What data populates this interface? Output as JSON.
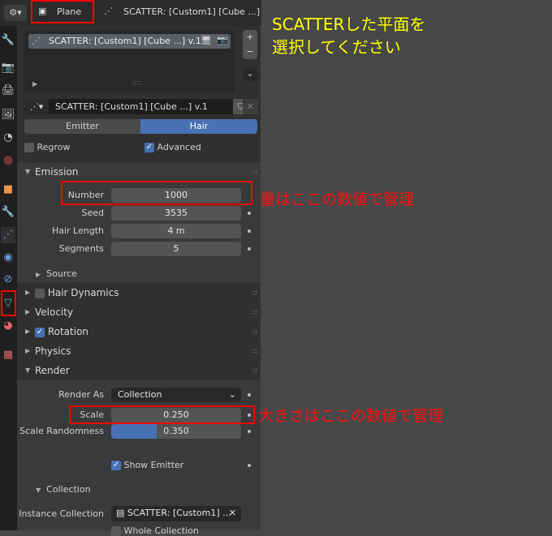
{
  "header": {
    "object_name": "Plane",
    "breadcrumb": "SCATTER: [Custom1] [Cube ...] v.1"
  },
  "particle_list": {
    "items": [
      {
        "name": "SCATTER: [Custom1] [Cube ...] v.1"
      }
    ]
  },
  "datablock": {
    "name": "SCATTER: [Custom1] [Cube ...] v.1"
  },
  "type_tabs": [
    {
      "label": "Emitter",
      "active": false
    },
    {
      "label": "Hair",
      "active": true
    }
  ],
  "options": {
    "regrow": "Regrow",
    "advanced": "Advanced"
  },
  "emission": {
    "title": "Emission",
    "fields": [
      {
        "label": "Number",
        "value": "1000"
      },
      {
        "label": "Seed",
        "value": "3535"
      },
      {
        "label": "Hair Length",
        "value": "4 m"
      },
      {
        "label": "Segments",
        "value": "5"
      }
    ],
    "source": "Source"
  },
  "panels": [
    "Hair Dynamics",
    "Velocity",
    "Rotation",
    "Physics"
  ],
  "render": {
    "title": "Render",
    "render_as_label": "Render As",
    "render_as_value": "Collection",
    "scale_label": "Scale",
    "scale_value": "0.250",
    "scale_rand_label": "Scale Randomness",
    "scale_rand_value": "0.350",
    "scale_rand_fraction": 0.35,
    "show_emitter": "Show Emitter",
    "collection_title": "Collection",
    "instance_label": "Instance Collection",
    "instance_value": "SCATTER: [Custom1] ...",
    "whole_collection": "Whole Collection"
  },
  "annotations": {
    "instruction": "SCATTERした平面を\n選択してください",
    "number_note": "量はここの数値で管理",
    "scale_note": "大きさはここの数値で管理"
  },
  "colors": {
    "accent": "#4772b3",
    "annotation_red": "#ff0000",
    "annotation_yellow": "#ffff00"
  }
}
